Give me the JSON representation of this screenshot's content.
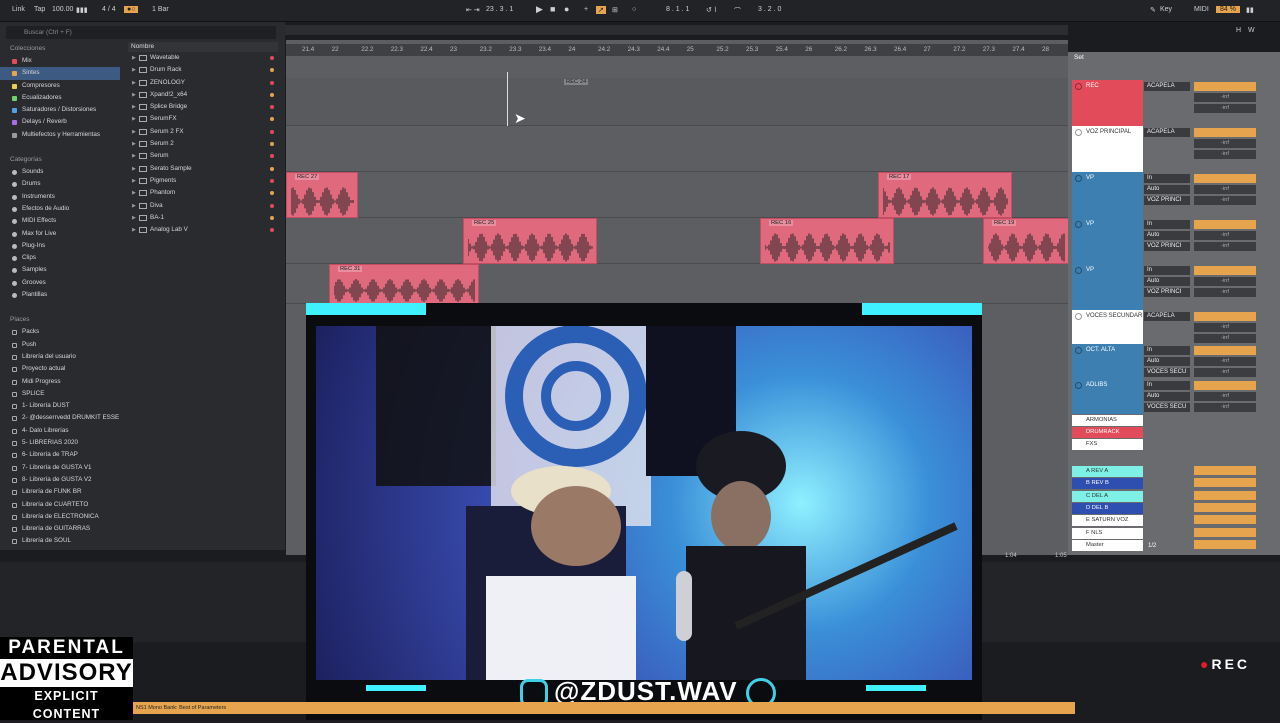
{
  "topbar": {
    "link": "Link",
    "tap": "Tap",
    "tempo": "100.00",
    "sig": "4 / 4",
    "quant": "1 Bar",
    "pos": "23 .  3 .  1",
    "loop_start": "8 .  1 .  1",
    "loop_len": "3 .  2 .  0",
    "key": "Key",
    "midi": "MIDI",
    "cpu": "84 %",
    "h": "H",
    "w": "W"
  },
  "browser": {
    "search": "Buscar (Ctrl + F)",
    "collections_hdr": "Colecciones",
    "collections": [
      {
        "label": "Mix",
        "color": "#e14b5a"
      },
      {
        "label": "Sintes",
        "color": "#e6a44f"
      },
      {
        "label": "Compresores",
        "color": "#e6d24f"
      },
      {
        "label": "Ecualizadores",
        "color": "#6fd26f"
      },
      {
        "label": "Saturadores / Distorsiones",
        "color": "#4fa2e6"
      },
      {
        "label": "Delays / Reverb",
        "color": "#a46fe6"
      },
      {
        "label": "Multiefectos y Herramientas",
        "color": "#9a9a9a"
      }
    ],
    "categories_hdr": "Categorías",
    "categories": [
      "Sounds",
      "Drums",
      "Instruments",
      "Efectos de Audio",
      "MIDI Effects",
      "Max for Live",
      "Plug-Ins",
      "Clips",
      "Samples",
      "Grooves",
      "Plantillas"
    ],
    "places_hdr": "Places",
    "places": [
      "Packs",
      "Push",
      "Librería del usuario",
      "Proyecto actual",
      "Midi Progress",
      "SPLICE",
      "1- Librería DUST",
      "2- @desserrvedd DRUMKIT ESSE",
      "4- Dalo Librerías",
      "5- LIBRERIAS 2020",
      "6- Librería de TRAP",
      "7- Librería de GUSTA V1",
      "8- Librería de GUSTA V2",
      "Librería de FUNK BR",
      "Librería de CUARTETO",
      "Librería de ELECTRONICA",
      "Librería de GUITARRAS",
      "Librería de SOUL"
    ],
    "files_hdr": "Nombre",
    "files": [
      "Wavetable",
      "Drum Rack",
      "ZENOLOGY",
      "Xpand!2_x64",
      "Splice Bridge",
      "SerumFX",
      "Serum 2 FX",
      "Serum 2",
      "Serum",
      "Serato Sample",
      "Pigments",
      "Phantom",
      "Diva",
      "BA-1",
      "Analog Lab V"
    ]
  },
  "ruler": [
    "21.4",
    "22",
    "22.2",
    "22.3",
    "22.4",
    "23",
    "23.2",
    "23.3",
    "23.4",
    "24",
    "24.2",
    "24.3",
    "24.4",
    "25",
    "25.2",
    "25.3",
    "25.4",
    "26",
    "26.2",
    "26.3",
    "26.4",
    "27",
    "27.2",
    "27.3",
    "27.4",
    "28"
  ],
  "clips": [
    {
      "name": "REC 24",
      "lane": 0
    },
    {
      "name": "REC 27",
      "lane": 1
    },
    {
      "name": "REC 17",
      "lane": 1
    },
    {
      "name": "REC 25",
      "lane": 2
    },
    {
      "name": "REC 16",
      "lane": 2
    },
    {
      "name": "REC 19",
      "lane": 2
    },
    {
      "name": "REC 31",
      "lane": 3
    }
  ],
  "mixer": {
    "set": "Set",
    "tracks": [
      {
        "name": "REC",
        "color": "#e14b5a",
        "io": [
          "ACAPELA"
        ]
      },
      {
        "name": "VOZ PRINCIPAL",
        "color": "#ffffff",
        "io": [
          "ACAPELA"
        ]
      },
      {
        "name": "VP",
        "color": "#3d7fb0",
        "io": [
          "In",
          "VOZ PRINCI"
        ]
      },
      {
        "name": "VP",
        "color": "#3d7fb0",
        "io": [
          "In",
          "VOZ PRINCI"
        ]
      },
      {
        "name": "VP",
        "color": "#3d7fb0",
        "io": [
          "In",
          "VOZ PRINCI"
        ]
      },
      {
        "name": "VOCES SECUNDARI",
        "color": "#ffffff",
        "io": [
          "ACAPELA"
        ]
      },
      {
        "name": "OCT. ALTA",
        "color": "#3d7fb0",
        "io": [
          "In",
          "VOCES SECU"
        ]
      },
      {
        "name": "ADLIBS",
        "color": "#3d7fb0",
        "io": [
          "In",
          "VOCES SECU"
        ]
      }
    ],
    "groups": [
      {
        "name": "ARMONIAS",
        "color": "#ffffff"
      },
      {
        "name": "DRUMRACK",
        "color": "#e14b5a"
      },
      {
        "name": "FXS",
        "color": "#ffffff"
      }
    ],
    "returns": [
      {
        "name": "A REV A",
        "color": "#7ef0e6"
      },
      {
        "name": "B REV B",
        "color": "#2f4fb0"
      },
      {
        "name": "C DEL A",
        "color": "#7ef0e6"
      },
      {
        "name": "D DEL B",
        "color": "#2f4fb0"
      },
      {
        "name": "E SATURN VOZ",
        "color": "#ffffff"
      },
      {
        "name": "F NLS",
        "color": "#ffffff"
      },
      {
        "name": "Master",
        "color": "#ffffff"
      }
    ],
    "master_io": "1/2",
    "auto": "Auto",
    "off": "Off",
    "inf": "-inf"
  },
  "overlay": {
    "social": "@ZDUST.WAV",
    "pa1": "PARENTAL",
    "pa2": "ADVISORY",
    "pa3": "EXPLICIT CONTENT",
    "rec": "REC",
    "status": "NS1 Mono Bank: Best of Parameters",
    "time1": "1:04",
    "time2": "1:05"
  }
}
